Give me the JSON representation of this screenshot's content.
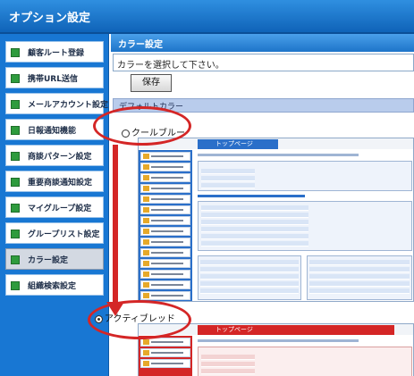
{
  "window": {
    "title": "オプション設定"
  },
  "sidebar": {
    "items": [
      {
        "label": "顧客ルート登録",
        "active": false
      },
      {
        "label": "携帯URL送信",
        "active": false
      },
      {
        "label": "メールアカウント設定",
        "active": false
      },
      {
        "label": "日報通知機能",
        "active": false
      },
      {
        "label": "商談パターン設定",
        "active": false
      },
      {
        "label": "重要商談通知設定",
        "active": false
      },
      {
        "label": "マイグループ設定",
        "active": false
      },
      {
        "label": "グループリスト設定",
        "active": false
      },
      {
        "label": "カラー設定",
        "active": true
      },
      {
        "label": "組織検索設定",
        "active": false
      }
    ]
  },
  "main": {
    "header": "カラー設定",
    "instruction": "カラーを選択して下さい。",
    "save_label": "保存",
    "section_label": "デフォルトカラー",
    "options": [
      {
        "label": "クールブルー",
        "selected": false,
        "preview_title": "トップページ",
        "accent": "#2a6fc9"
      },
      {
        "label": "アクティブレッド",
        "selected": true,
        "preview_title": "トップページ",
        "accent": "#d42626"
      }
    ]
  },
  "colors": {
    "titlebar": "#1877d3",
    "sidebar": "#1877d3",
    "active_item": "#d3d9e2",
    "bullet": "#2e9b3d",
    "annotation": "#d42626"
  }
}
